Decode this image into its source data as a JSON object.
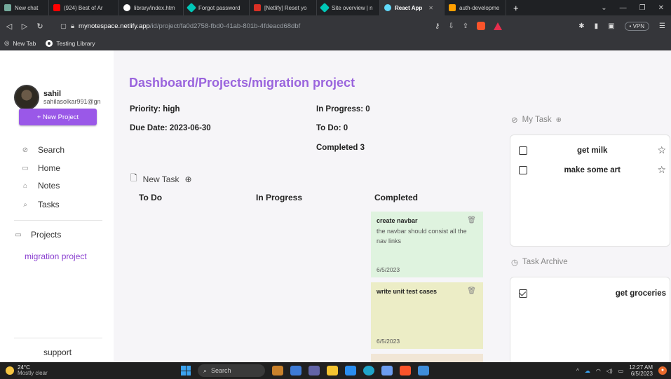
{
  "browser": {
    "tabs": [
      {
        "label": "New chat",
        "color": "#74aa9c"
      },
      {
        "label": "(924) Best of Ar",
        "color": "#ff0000"
      },
      {
        "label": "library/index.htm",
        "color": "#ffffff"
      },
      {
        "label": "Forgot password",
        "color": "#00c7b7"
      },
      {
        "label": "[Netlify] Reset yo",
        "color": "#d93025"
      },
      {
        "label": "Site overview | n",
        "color": "#00c7b7"
      },
      {
        "label": "React App",
        "color": "#61dafb"
      },
      {
        "label": "auth-developme",
        "color": "#ffa000"
      }
    ],
    "url_host": "mynotespace.netlify.app",
    "url_path": "/id/project/fa0d2758-fbd0-41ab-801b-4fdeacd68dbf",
    "vpn_label": "• VPN",
    "bookmarks": [
      "New Tab",
      "Testing Library"
    ]
  },
  "user": {
    "name": "sahil",
    "email": "sahilasolkar991@gn"
  },
  "sidebar": {
    "new_project_label": "+ New Project",
    "nav": [
      {
        "label": "Search",
        "icon": "search-icon"
      },
      {
        "label": "Home",
        "icon": "home-icon"
      },
      {
        "label": "Notes",
        "icon": "notes-icon"
      },
      {
        "label": "Tasks",
        "icon": "tasks-icon"
      }
    ],
    "projects_label": "Projects",
    "projects": [
      "migration project"
    ],
    "support_label": "support"
  },
  "main": {
    "title": "Dashboard/Projects/migration project",
    "priority": "Priority: high",
    "due_date": "Due Date: 2023-06-30",
    "in_progress": "In Progress: 0",
    "to_do": "To Do: 0",
    "completed": "Completed 3",
    "new_task_label": "New Task",
    "columns": [
      "To Do",
      "In Progress",
      "Completed"
    ],
    "completed_cards": [
      {
        "title": "create navbar",
        "description": "the navbar should consist all the nav links",
        "date": "6/5/2023",
        "color": "#dff3df"
      },
      {
        "title": "write unit test cases",
        "description": "",
        "date": "6/5/2023",
        "color": "#ecedc6"
      }
    ]
  },
  "my_task": {
    "label": "My Task",
    "items": [
      "get milk",
      "make some art"
    ]
  },
  "task_archive": {
    "label": "Task Archive",
    "items": [
      "get groceries"
    ]
  },
  "taskbar": {
    "temperature": "24°C",
    "condition": "Mostly clear",
    "search_label": "Search",
    "time": "12:27 AM",
    "date": "6/5/2023"
  },
  "colors": {
    "accent": "#9a58e8",
    "title": "#9a64dd",
    "project_link": "#8a3fd0"
  }
}
